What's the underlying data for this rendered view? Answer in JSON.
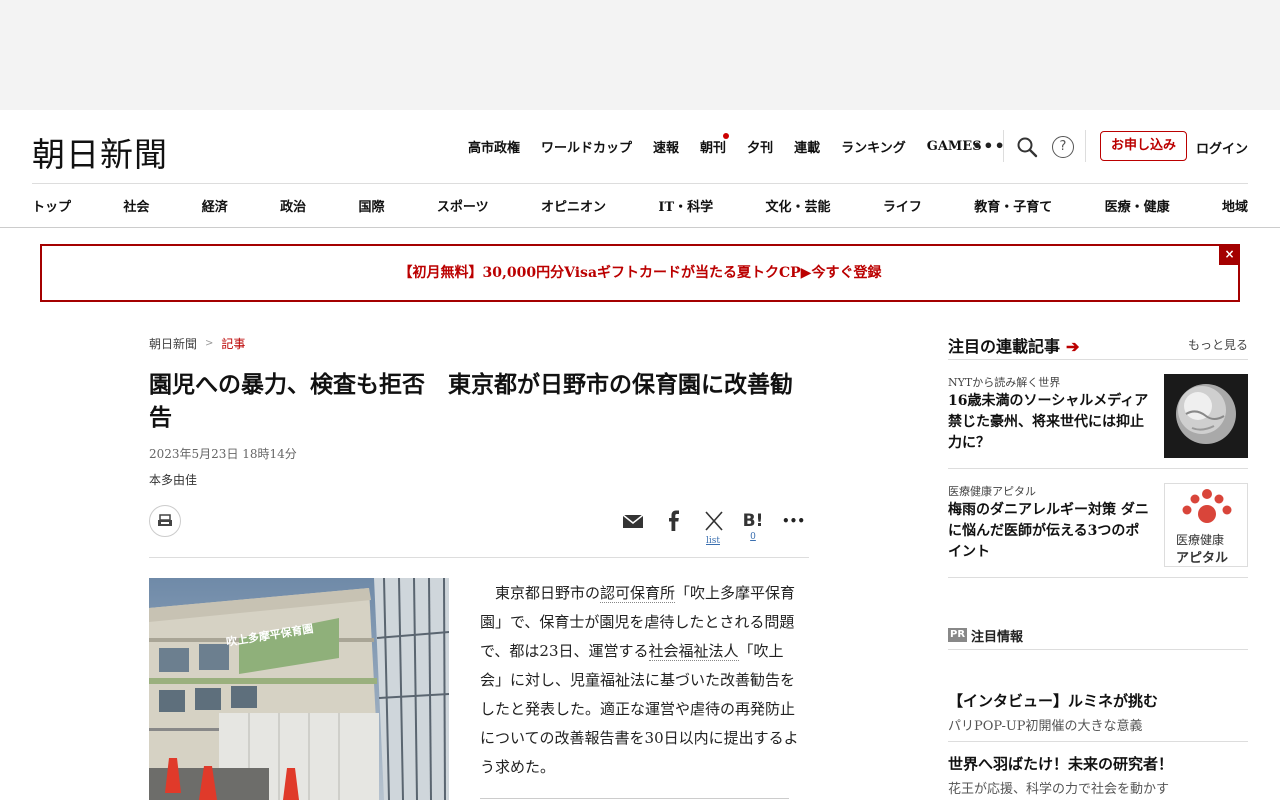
{
  "header": {
    "logo": "朝日新聞",
    "topnav": [
      "高市政権",
      "ワールドカップ",
      "速報",
      "朝刊",
      "夕刊",
      "連載",
      "ランキング",
      "GAMES"
    ],
    "more": "•••",
    "help": "?",
    "subscribe": "お申し込み",
    "login": "ログイン"
  },
  "catnav": [
    "トップ",
    "社会",
    "経済",
    "政治",
    "国際",
    "スポーツ",
    "オピニオン",
    "IT・科学",
    "文化・芸能",
    "ライフ",
    "教育・子育て",
    "医療・健康",
    "地域"
  ],
  "banner": {
    "text": "【初月無料】30,000円分Visaギフトカードが当たる夏トクCP▶今すぐ登録",
    "close": "×"
  },
  "article": {
    "breadcrumb": [
      "朝日新聞",
      "記事"
    ],
    "breadcrumb_sep": ">",
    "headline": "園児への暴力、検査も拒否　東京都が日野市の保育園に改善勧告",
    "date": "2023年5月23日 18時14分",
    "author": "本多由佳",
    "share": {
      "x_sub": "list",
      "hatena": "B!",
      "hatena_sub": "0",
      "more": "•••"
    },
    "photo_sign": "吹上多摩平保育園",
    "body": {
      "p1": "東京都日野市の",
      "link1": "認可保育所",
      "p2": "「吹上多摩平保育園」で、保育士が園児を虐待したとされる問題で、都は23日、運営する",
      "link2": "社会福祉法人",
      "p3": "「吹上会」に対し、児童福祉法に基づいた改善勧告をしたと発表した。適正な運営や虐待の再発防止についての改善報告書を30日以内に提出するよう求めた。"
    }
  },
  "sidebar": {
    "title": "注目の連載記事",
    "arrow": "➔",
    "more": "もっと見る",
    "items": [
      {
        "category": "NYTから読み解く世界",
        "title": "16歳未満のソーシャルメディア禁じた豪州、将来世代には抑止力に？"
      },
      {
        "category": "医療健康アピタル",
        "title": "梅雨のダニアレルギー対策 ダニに悩んだ医師が伝える3つのポイント",
        "thumb_text1": "医療健康",
        "thumb_text2": "アピタル"
      }
    ]
  },
  "pr": {
    "badge": "PR",
    "title": "注目情報",
    "items": [
      {
        "title": "【インタビュー】ルミネが挑む",
        "sub": "パリPOP-UP初開催の大きな意義"
      },
      {
        "title": "世界へ羽ばたけ！未来の研究者！",
        "sub": "花王が応援、科学の力で社会を動かす"
      }
    ]
  },
  "colors": {
    "accent": "#b00000",
    "link_blue": "#3a6fb0"
  }
}
